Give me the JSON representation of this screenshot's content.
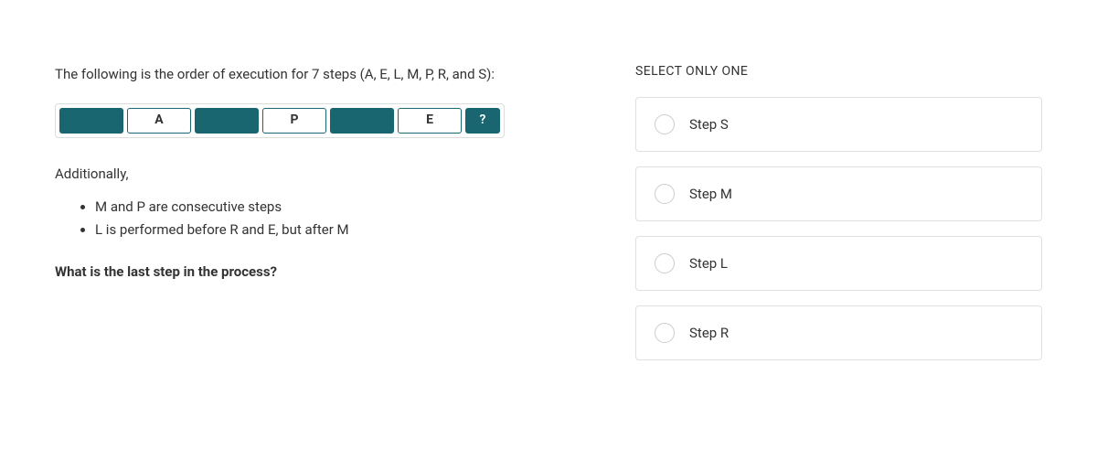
{
  "question": {
    "intro": "The following is the order of execution for 7 steps (A, E, L, M, P, R, and S):",
    "steps": [
      {
        "label": "",
        "kind": "blank"
      },
      {
        "label": "A",
        "kind": "labeled"
      },
      {
        "label": "",
        "kind": "blank"
      },
      {
        "label": "P",
        "kind": "labeled"
      },
      {
        "label": "",
        "kind": "blank"
      },
      {
        "label": "E",
        "kind": "labeled"
      },
      {
        "label": "?",
        "kind": "unknown"
      }
    ],
    "additionally_label": "Additionally,",
    "clues": [
      "M and P are consecutive steps",
      "L is performed before R and E, but after M"
    ],
    "prompt": "What is the last step in the process?"
  },
  "answers": {
    "instruction": "SELECT ONLY ONE",
    "options": [
      {
        "label": "Step S"
      },
      {
        "label": "Step M"
      },
      {
        "label": "Step L"
      },
      {
        "label": "Step R"
      }
    ]
  }
}
